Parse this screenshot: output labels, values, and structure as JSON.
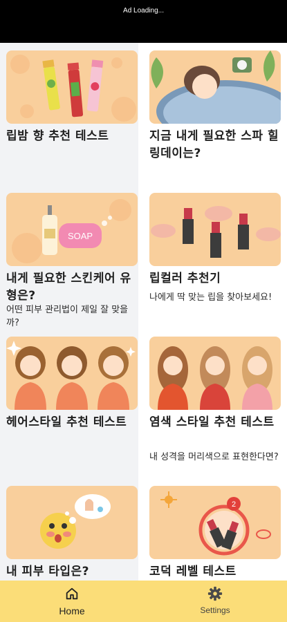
{
  "ad": {
    "text": "Ad Loading..."
  },
  "cards": [
    {
      "title": "립밤 향 추천 테스트",
      "subtitle": ""
    },
    {
      "title": "지금 내게 필요한 스파 힐링데이는?",
      "subtitle": ""
    },
    {
      "title": "내게 필요한 스킨케어 유형은?",
      "subtitle": "어떤 피부 관리법이 제일 잘 맞을까?",
      "image_text": "SOAP"
    },
    {
      "title": "립컬러 추천기",
      "subtitle": "나에게 딱 맞는 립을 찾아보세요!"
    },
    {
      "title": "헤어스타일 추천 테스트",
      "subtitle": ""
    },
    {
      "title": "염색 스타일 추천 테스트",
      "subtitle": "내 성격을 머리색으로 표현한다면?"
    },
    {
      "title": "내 피부 타입은?",
      "subtitle": ""
    },
    {
      "title": "코덕 레벨 테스트",
      "subtitle": "",
      "badge": "2"
    }
  ],
  "nav": {
    "home_label": "Home",
    "settings_label": "Settings",
    "home_icon": "home-icon",
    "settings_icon": "gear-icon",
    "background": "#fbdd78"
  },
  "colors": {
    "thumb_peach": "#f9cf9c",
    "card_grey": "#f2f3f5",
    "nav_yellow": "#fbdd78"
  }
}
